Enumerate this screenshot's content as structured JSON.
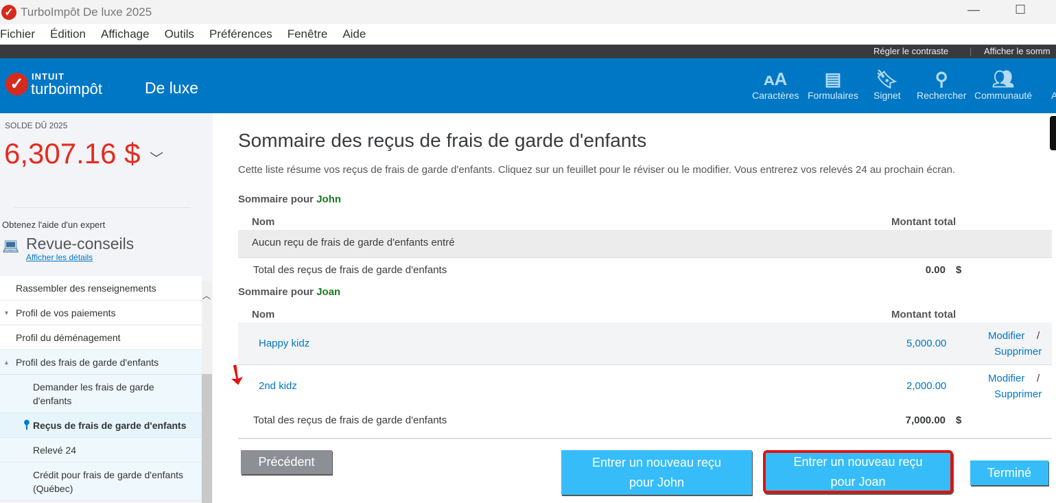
{
  "window": {
    "title": "TurboImpôt De luxe 2025"
  },
  "menu": [
    "Fichier",
    "Édition",
    "Affichage",
    "Outils",
    "Préférences",
    "Fenêtre",
    "Aide"
  ],
  "topbar": {
    "contrast": "Régler le contraste",
    "summary": "Afficher le somm"
  },
  "header": {
    "logo_brand": "INTUIT",
    "logo_product": "turboimpôt",
    "edition": "De luxe",
    "tools": [
      {
        "label": "Caractères",
        "icon": "font-size-icon"
      },
      {
        "label": "Formulaires",
        "icon": "document-icon"
      },
      {
        "label": "Signet",
        "icon": "bookmark-icon"
      },
      {
        "label": "Rechercher",
        "icon": "search-icon"
      },
      {
        "label": "Communauté",
        "icon": "community-icon"
      },
      {
        "label": "A",
        "icon": "help-icon"
      }
    ]
  },
  "sidebar": {
    "balance_label": "SOLDE DÛ 2025",
    "balance": "6,307.16 $",
    "expert_label": "Obtenez l'aide d'un expert",
    "review_title": "Revue-conseils",
    "review_link": "Afficher les détails",
    "nav": [
      "Rassembler des renseignements",
      "Profil de vos paiements",
      "Profil du déménagement",
      "Profil des frais de garde d'enfants",
      "Demander les frais de garde d'enfants",
      "Reçus de frais de garde d'enfants",
      "Relevé 24",
      "Crédit pour frais de garde d'enfants (Québec)"
    ]
  },
  "main": {
    "title": "Sommaire des reçus de frais de garde d'enfants",
    "intro": "Cette liste résume vos reçus de frais de garde d'enfants. Cliquez sur un feuillet pour le réviser ou le modifier. Vous entrerez vos relevés 24 au prochain écran.",
    "summary_prefix": "Sommaire pour",
    "col_name": "Nom",
    "col_amount": "Montant total",
    "total_label": "Total des reçus de frais de garde d'enfants",
    "currency": "$",
    "modify": "Modifier",
    "delete": "Supprimer",
    "slash": "/",
    "john": {
      "name": "John",
      "empty": "Aucun reçu de frais de garde d'enfants entré",
      "total": "0.00"
    },
    "joan": {
      "name": "Joan",
      "receipts": [
        {
          "name": "Happy kidz",
          "amount": "5,000.00"
        },
        {
          "name": "2nd kidz",
          "amount": "2,000.00"
        }
      ],
      "total": "7,000.00"
    }
  },
  "buttons": {
    "previous": "Précédent",
    "new_john": "Entrer un nouveau reçu pour John",
    "new_joan": "Entrer un nouveau reçu pour Joan",
    "done": "Terminé"
  },
  "colors": {
    "brand_blue": "#0077c5",
    "button_blue": "#36bdf9",
    "balance_red": "#e52b20",
    "highlight": "#e0140f"
  }
}
